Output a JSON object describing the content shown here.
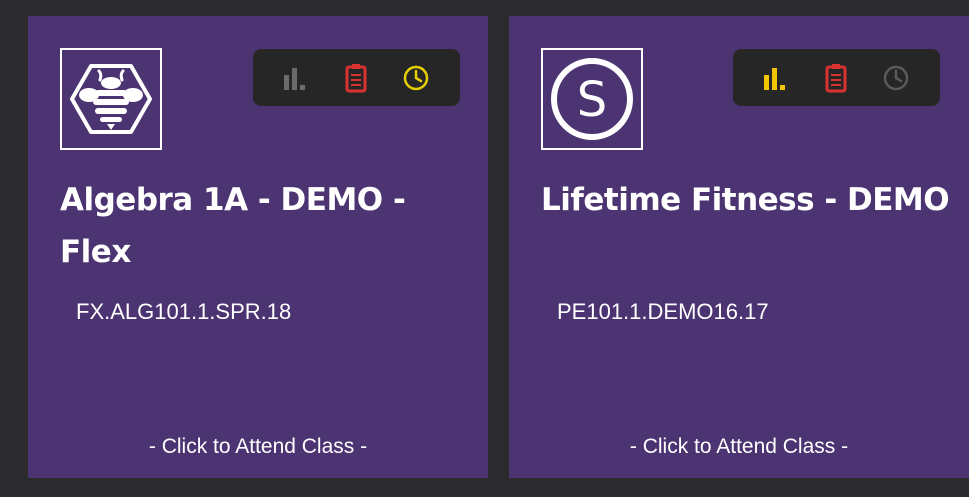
{
  "courses": [
    {
      "title": "Algebra 1A - DEMO - Flex",
      "code": "FX.ALG101.1.SPR.18",
      "action": "- Click to Attend Class -",
      "logo": "bee-hexagon-icon",
      "status_icons": [
        {
          "name": "grades-bar-chart-icon",
          "color": "#6b6b6b"
        },
        {
          "name": "assignments-clipboard-icon",
          "color": "#d9322f"
        },
        {
          "name": "attendance-clock-icon",
          "color": "#e6cf00"
        }
      ]
    },
    {
      "title": "Lifetime Fitness - DEMO",
      "code": "PE101.1.DEMO16.17",
      "action": "- Click to Attend Class -",
      "logo": "schoology-s-icon",
      "status_icons": [
        {
          "name": "grades-bar-chart-icon",
          "color": "#f2c500"
        },
        {
          "name": "assignments-clipboard-icon",
          "color": "#d9322f"
        },
        {
          "name": "attendance-clock-icon",
          "color": "#5a5a5a"
        }
      ]
    }
  ],
  "colors": {
    "page_bg": "#2b2b2d",
    "card_bg": "#4b3471",
    "status_bar_bg": "#262626",
    "text": "#ffffff"
  }
}
